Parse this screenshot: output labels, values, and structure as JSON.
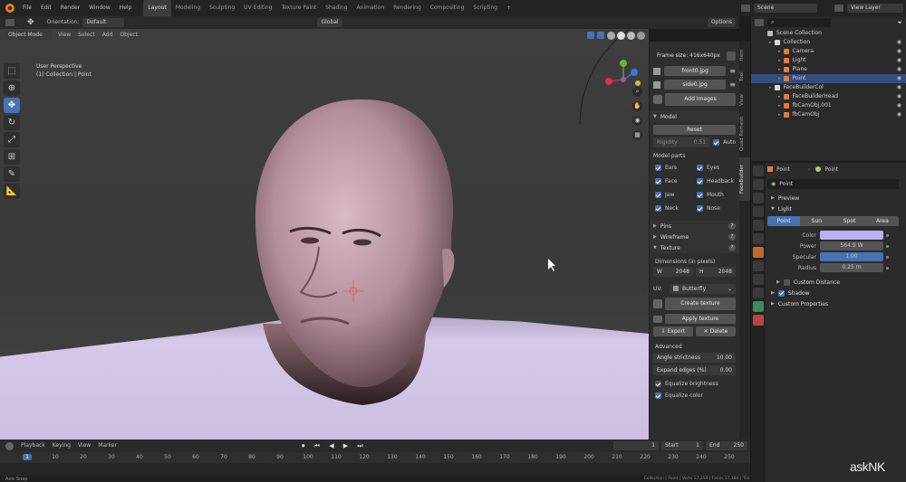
{
  "topbar": {
    "menus": [
      "File",
      "Edit",
      "Render",
      "Window",
      "Help"
    ],
    "workspaces": [
      "Layout",
      "Modeling",
      "Sculpting",
      "UV Editing",
      "Texture Paint",
      "Shading",
      "Animation",
      "Rendering",
      "Compositing",
      "Scripting"
    ],
    "active_workspace": "Layout",
    "add_tab": "+",
    "scene": "Scene",
    "view_layer": "View Layer"
  },
  "header": {
    "orientation_label": "Orientation:",
    "orientation_value": "Default",
    "transform_space": "Global",
    "options": "Options",
    "mode": "Object Mode",
    "menus": [
      "View",
      "Select",
      "Add",
      "Object"
    ]
  },
  "viewport": {
    "view_name": "User Perspective",
    "collection_info": "(1) Collection | Point"
  },
  "npanel": {
    "frame_size": "Frame size: 416x640px",
    "images": [
      "front0.jpg",
      "side0.jpg"
    ],
    "add_images": "Add Images",
    "model_title": "Model",
    "reset": "Reset",
    "rigidity_label": "Rigidity",
    "rigidity_value": "0.51",
    "auto_label": "Auto",
    "model_parts_title": "Model parts",
    "parts": [
      [
        "Ears",
        "Eyes"
      ],
      [
        "Face",
        "Headback"
      ],
      [
        "Jaw",
        "Mouth"
      ],
      [
        "Neck",
        "Nose"
      ]
    ],
    "pins": "Pins",
    "wireframe": "Wireframe",
    "texture": "Texture",
    "dimensions_label": "Dimensions (in pixels)",
    "w_label": "W",
    "w_value": "2048",
    "h_label": "H",
    "h_value": "2048",
    "uv_label": "UV:",
    "uv_value": "Butterfly",
    "create_texture": "Create texture",
    "apply_texture": "Apply texture",
    "export": "Export",
    "delete": "Delete",
    "advanced": "Advanced",
    "angle_label": "Angle strictness",
    "angle_value": "10.00",
    "expand_label": "Expand edges (%)",
    "expand_value": "0.00",
    "equalize_brightness": "Equalize brightness",
    "equalize_color": "Equalize color",
    "tabs": [
      "Item",
      "Tool",
      "View",
      "Quad Remesh",
      "FaceBuilder"
    ]
  },
  "timeline": {
    "menus": [
      "Playback",
      "Keying",
      "View",
      "Marker"
    ],
    "current_frame": "1",
    "start_label": "Start",
    "start_value": "1",
    "end_label": "End",
    "end_value": "250",
    "ruler": [
      "1",
      "10",
      "20",
      "30",
      "40",
      "50",
      "60",
      "70",
      "80",
      "90",
      "100",
      "110",
      "120",
      "130",
      "140",
      "150",
      "160",
      "170",
      "180",
      "190",
      "200",
      "210",
      "220",
      "230",
      "240",
      "250"
    ],
    "status_left": "Axis Snap",
    "status_right": "Collection | Point | Verts 17,254 | Faces 17,184 | Tris 34,364 | Objects 1/7 | Mem: 73.1 MiB | v2.83.1"
  },
  "outliner": {
    "title": "Scene Collection",
    "items": [
      {
        "label": "Collection",
        "indent": 1,
        "color": "#d6d6d6",
        "sel": false
      },
      {
        "label": "Camera",
        "indent": 2,
        "color": "#e07c3c",
        "sel": false
      },
      {
        "label": "Light",
        "indent": 2,
        "color": "#e07c3c",
        "sel": false
      },
      {
        "label": "Plane",
        "indent": 2,
        "color": "#e07c3c",
        "sel": false
      },
      {
        "label": "Point",
        "indent": 2,
        "color": "#e07c3c",
        "sel": true
      },
      {
        "label": "FaceBuilderCol",
        "indent": 1,
        "color": "#d6d6d6",
        "sel": false
      },
      {
        "label": "FaceBuilderHead",
        "indent": 2,
        "color": "#e07c3c",
        "sel": false
      },
      {
        "label": "fbCamObj.001",
        "indent": 2,
        "color": "#e07c3c",
        "sel": false
      },
      {
        "label": "fbCamObj",
        "indent": 2,
        "color": "#e07c3c",
        "sel": false
      }
    ]
  },
  "properties": {
    "object": "Point",
    "data": "Point",
    "data_name": "Point",
    "preview": "Preview",
    "light": "Light",
    "light_types": [
      "Point",
      "Sun",
      "Spot",
      "Area"
    ],
    "color_label": "Color",
    "color_value": "#b9b1f0",
    "power_label": "Power",
    "power_value": "564.9 W",
    "specular_label": "Specular",
    "specular_value": "1.00",
    "radius_label": "Radius",
    "radius_value": "0.25 m",
    "custom_distance": "Custom Distance",
    "shadow": "Shadow",
    "custom_properties": "Custom Properties"
  },
  "watermark": "askNK",
  "colors": {
    "accent": "#4772b3",
    "selected": "#334d80",
    "orange": "#e87d0d"
  }
}
